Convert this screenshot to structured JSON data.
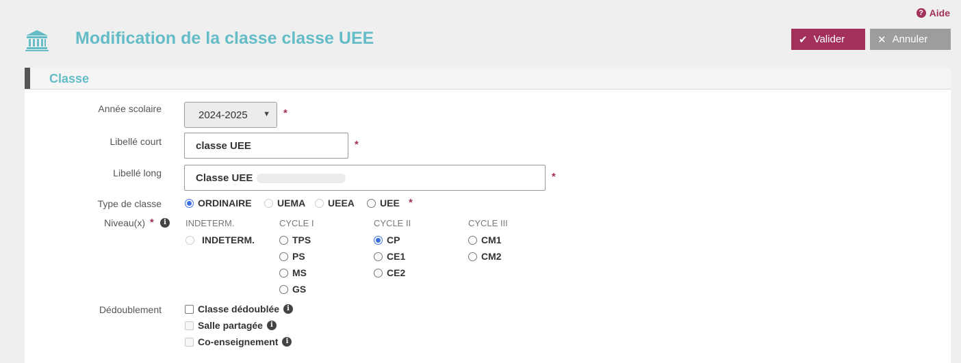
{
  "header": {
    "help_label": "Aide",
    "title": "Modification de la classe classe UEE",
    "validate_label": "Valider",
    "cancel_label": "Annuler",
    "brand_color": "#a3305a",
    "title_color": "#64bcc6"
  },
  "section": {
    "title": "Classe"
  },
  "form": {
    "school_year": {
      "label": "Année scolaire",
      "value": "2024-2025"
    },
    "short_label": {
      "label": "Libellé court",
      "value": "classe UEE"
    },
    "long_label": {
      "label": "Libellé long",
      "value": "Classe UEE"
    },
    "class_type": {
      "label": "Type de classe",
      "options": [
        {
          "label": "ORDINAIRE",
          "state": "checked"
        },
        {
          "label": "UEMA",
          "state": "disabled"
        },
        {
          "label": "UEEA",
          "state": "disabled"
        },
        {
          "label": "UEE",
          "state": "unchecked"
        }
      ]
    },
    "levels": {
      "label": "Niveau(x)",
      "columns": [
        {
          "header": "INDETERM.",
          "options": [
            {
              "label": "INDETERM.",
              "state": "disabled"
            }
          ]
        },
        {
          "header": "CYCLE I",
          "options": [
            {
              "label": "TPS",
              "state": "unchecked"
            },
            {
              "label": "PS",
              "state": "unchecked"
            },
            {
              "label": "MS",
              "state": "unchecked"
            },
            {
              "label": "GS",
              "state": "unchecked"
            }
          ]
        },
        {
          "header": "CYCLE II",
          "options": [
            {
              "label": "CP",
              "state": "checked"
            },
            {
              "label": "CE1",
              "state": "unchecked"
            },
            {
              "label": "CE2",
              "state": "unchecked"
            }
          ]
        },
        {
          "header": "CYCLE III",
          "options": [
            {
              "label": "CM1",
              "state": "unchecked"
            },
            {
              "label": "CM2",
              "state": "unchecked"
            }
          ]
        }
      ]
    },
    "split": {
      "label": "Dédoublement",
      "options": [
        {
          "label": "Classe dédoublée",
          "state": "unchecked"
        },
        {
          "label": "Salle partagée",
          "state": "disabled"
        },
        {
          "label": "Co-enseignement",
          "state": "disabled"
        }
      ]
    },
    "required_mark": "*",
    "info_mark": "i"
  }
}
